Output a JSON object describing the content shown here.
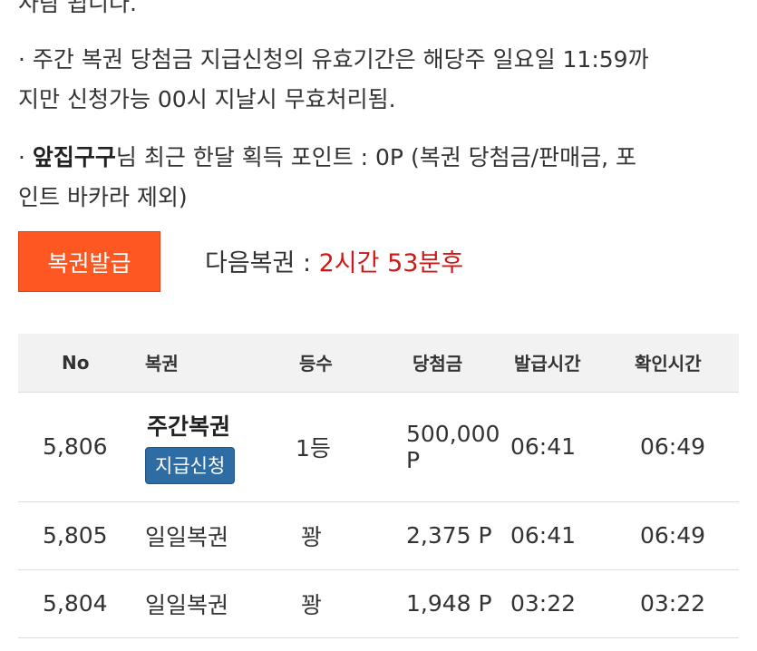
{
  "top_partial": "사람 됩니다.",
  "notice": {
    "line1": "· 주간 복권 당첨금 지급신청의 유효기간은 해당주 일요일 11:59까",
    "line2": "지만 신청가능 00시 지날시 무효처리됨.",
    "points_prefix": "· ",
    "user": "앞집구구",
    "points_mid": "님 최근 한달 획득 포인트 : 0P (복권 당첨금/판매금, 포",
    "line4": "인트 바카라 제외)"
  },
  "issue_button": "복권발급",
  "next_lottery": {
    "label": "다음복권 : ",
    "time": "2시간 53분후"
  },
  "table": {
    "headers": [
      "No",
      "복권",
      "등수",
      "당첨금",
      "발급시간",
      "확인시간"
    ],
    "rows": [
      {
        "no": "5,806",
        "name": "주간복권",
        "claim": "지급신청",
        "rank": "1등",
        "prize": "500,000 P",
        "issued": "06:41",
        "checked": "06:49"
      },
      {
        "no": "5,805",
        "name": "일일복권",
        "rank": "꽝",
        "prize": "2,375 P",
        "issued": "06:41",
        "checked": "06:49"
      },
      {
        "no": "5,804",
        "name": "일일복권",
        "rank": "꽝",
        "prize": "1,948 P",
        "issued": "03:22",
        "checked": "03:22"
      }
    ]
  }
}
